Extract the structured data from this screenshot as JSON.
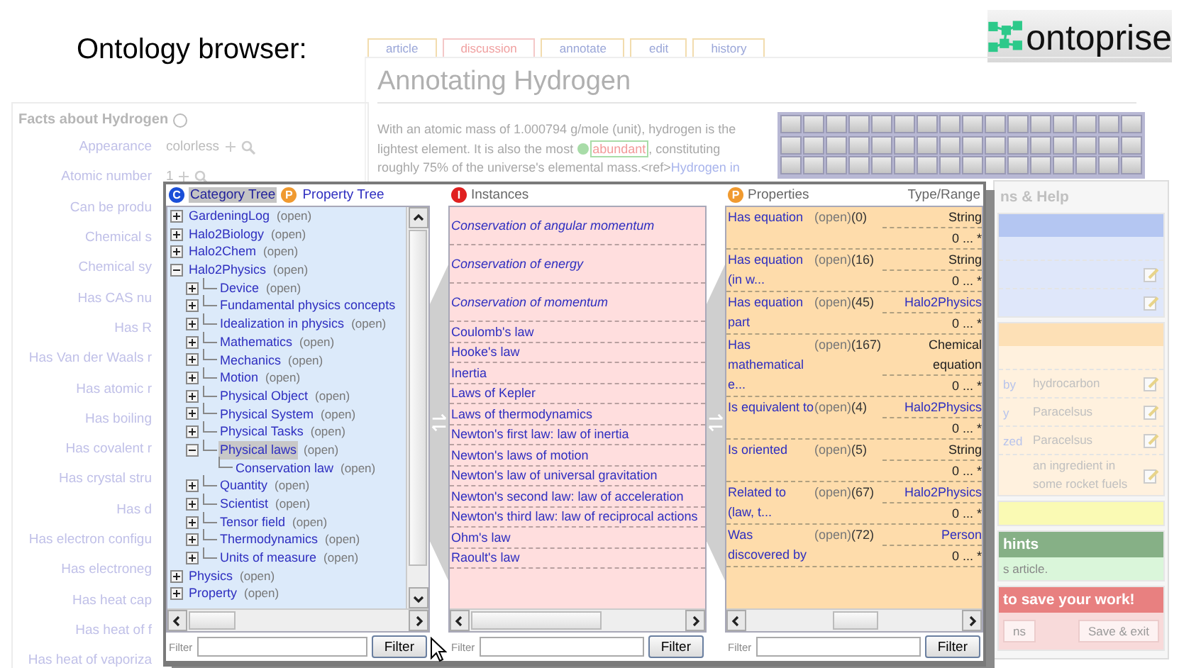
{
  "heading": "Ontology browser:",
  "logo": {
    "text": "ontoprise"
  },
  "wiki": {
    "tabs": [
      {
        "label": "article",
        "kind": "page"
      },
      {
        "label": "discussion",
        "kind": "missing"
      },
      {
        "label": "annotate",
        "kind": "page"
      },
      {
        "label": "edit",
        "kind": "page"
      },
      {
        "label": "history",
        "kind": "page"
      }
    ],
    "title": "Annotating Hydrogen",
    "paragraph": {
      "before": "With an atomic mass of 1.000794 g/mole (unit), hydrogen is the lightest element. It is also the most ",
      "annotated": "abundant",
      "after": ", constituting roughly 75% of the universe's elemental mass.<ref>",
      "link": "Hydrogen in"
    }
  },
  "facts": {
    "title": "Facts about Hydrogen",
    "rows": [
      {
        "label": "Appearance",
        "value": "colorless"
      },
      {
        "label": "Atomic number",
        "value": "1"
      },
      {
        "label": "Can be produ"
      },
      {
        "label": "Chemical s"
      },
      {
        "label": "Chemical sy"
      },
      {
        "label": "Has CAS nu"
      },
      {
        "label": "Has R"
      },
      {
        "label": "Has Van der Waals r"
      },
      {
        "label": "Has atomic r"
      },
      {
        "label": "Has boiling"
      },
      {
        "label": "Has covalent r"
      },
      {
        "label": "Has crystal stru"
      },
      {
        "label": "Has d"
      },
      {
        "label": "Has electron configu"
      },
      {
        "label": "Has electroneg"
      },
      {
        "label": "Has heat cap"
      },
      {
        "label": "Has heat of f"
      },
      {
        "label": "Has heat of vaporiza"
      }
    ]
  },
  "help": {
    "title": "ns & Help",
    "fact_rows": [
      {
        "label": "by",
        "value": "hydrocarbon"
      },
      {
        "label": "y",
        "value": "Paracelsus"
      },
      {
        "label": "zed",
        "value": "Paracelsus"
      },
      {
        "value": "an ingredient in some rocket fuels"
      }
    ],
    "hints_title": "hints",
    "hints_text": "s article.",
    "save_title": "to save your work!",
    "buttons": [
      "ns",
      "Save & exit"
    ]
  },
  "browser": {
    "tree_tabs": [
      {
        "label": "Category Tree",
        "icon": "C",
        "selected": true
      },
      {
        "label": "Property Tree",
        "icon": "P",
        "selected": false
      }
    ],
    "tree": [
      {
        "label": "GardeningLog",
        "note": "(open)",
        "kind": "node",
        "expanded": false,
        "selected": false
      },
      {
        "label": "Halo2Biology",
        "note": "(open)",
        "kind": "node",
        "expanded": false,
        "selected": false
      },
      {
        "label": "Halo2Chem",
        "note": "(open)",
        "kind": "node",
        "expanded": false,
        "selected": false
      },
      {
        "label": "Halo2Physics",
        "note": "(open)",
        "kind": "node",
        "expanded": true,
        "selected": false,
        "children": [
          {
            "label": "Device",
            "note": "(open)",
            "kind": "node",
            "expanded": false,
            "selected": false
          },
          {
            "label": "Fundamental physics concepts",
            "kind": "node",
            "expanded": false,
            "selected": false
          },
          {
            "label": "Idealization in physics",
            "note": "(open)",
            "kind": "node",
            "expanded": false,
            "selected": false
          },
          {
            "label": "Mathematics",
            "note": "(open)",
            "kind": "node",
            "expanded": false,
            "selected": false
          },
          {
            "label": "Mechanics",
            "note": "(open)",
            "kind": "node",
            "expanded": false,
            "selected": false
          },
          {
            "label": "Motion",
            "note": "(open)",
            "kind": "node",
            "expanded": false,
            "selected": false
          },
          {
            "label": "Physical Object",
            "note": "(open)",
            "kind": "node",
            "expanded": false,
            "selected": false
          },
          {
            "label": "Physical System",
            "note": "(open)",
            "kind": "node",
            "expanded": false,
            "selected": false
          },
          {
            "label": "Physical Tasks",
            "note": "(open)",
            "kind": "node",
            "expanded": false,
            "selected": false
          },
          {
            "label": "Physical laws",
            "note": "(open)",
            "kind": "node",
            "expanded": true,
            "selected": true,
            "children": [
              {
                "label": "Conservation law",
                "note": "(open)",
                "kind": "leaf",
                "selected": false
              }
            ]
          },
          {
            "label": "Quantity",
            "note": "(open)",
            "kind": "node",
            "expanded": false,
            "selected": false
          },
          {
            "label": "Scientist",
            "note": "(open)",
            "kind": "node",
            "expanded": false,
            "selected": false
          },
          {
            "label": "Tensor field",
            "note": "(open)",
            "kind": "node",
            "expanded": false,
            "selected": false
          },
          {
            "label": "Thermodynamics",
            "note": "(open)",
            "kind": "node",
            "expanded": false,
            "selected": false
          },
          {
            "label": "Units of measure",
            "note": "(open)",
            "kind": "node",
            "expanded": false,
            "selected": false
          }
        ]
      },
      {
        "label": "Physics",
        "note": "(open)",
        "kind": "node",
        "expanded": false,
        "selected": false
      },
      {
        "label": "Property",
        "note": "(open)",
        "kind": "node",
        "expanded": false,
        "selected": false
      }
    ],
    "tree_filter": {
      "label": "Filter",
      "button": "Filter"
    },
    "instances_header": {
      "icon": "I",
      "label": "Instances"
    },
    "instances": [
      {
        "label": "Conservation of angular momentum",
        "kind": "italic"
      },
      {
        "label": "Conservation of energy",
        "kind": "italic"
      },
      {
        "label": "Conservation of momentum",
        "kind": "italic"
      },
      {
        "label": "Coulomb's law",
        "kind": "plain"
      },
      {
        "label": "Hooke's law",
        "kind": "plain"
      },
      {
        "label": "Inertia",
        "kind": "plain"
      },
      {
        "label": "Laws of Kepler",
        "kind": "plain"
      },
      {
        "label": "Laws of thermodynamics",
        "kind": "plain"
      },
      {
        "label": "Newton's first law: law of inertia",
        "kind": "plain"
      },
      {
        "label": "Newton's laws of motion",
        "kind": "plain"
      },
      {
        "label": "Newton's law of universal gravitation",
        "kind": "plain"
      },
      {
        "label": "Newton's second law: law of acceleration",
        "kind": "plain"
      },
      {
        "label": "Newton's third law: law of reciprocal actions",
        "kind": "plain"
      },
      {
        "label": "Ohm's law",
        "kind": "plain"
      },
      {
        "label": "Raoult's law",
        "kind": "plain"
      }
    ],
    "instances_filter": {
      "label": "Filter",
      "button": "Filter"
    },
    "properties_header": {
      "icon": "P",
      "label": "Properties",
      "range_label": "Type/Range"
    },
    "properties": [
      {
        "name": "Has equation",
        "note": "(open)",
        "count": "(0)",
        "range": "String",
        "kind": "datatype",
        "cardinality": "0 ... *"
      },
      {
        "name": "Has equation (in w...",
        "note": "(open)",
        "count": "(16)",
        "range": "String",
        "kind": "datatype",
        "cardinality": "0 ... *"
      },
      {
        "name": "Has equation part",
        "note": "(open)",
        "count": "(45)",
        "range": "Halo2Physics",
        "kind": "category",
        "cardinality": "0 ... *"
      },
      {
        "name": "Has mathematical e...",
        "note": "(open)",
        "count": "(167)",
        "range": "Chemical equation",
        "kind": "datatype",
        "cardinality": "0 ... *"
      },
      {
        "name": "Is equivalent to",
        "note": "(open)",
        "count": "(4)",
        "range": "Halo2Physics",
        "kind": "category",
        "cardinality": "0 ... *"
      },
      {
        "name": "Is oriented",
        "note": "(open)",
        "count": "(5)",
        "range": "String",
        "kind": "datatype",
        "cardinality": "0 ... *"
      },
      {
        "name": "Related to (law, t...",
        "note": "(open)",
        "count": "(67)",
        "range": "Halo2Physics",
        "kind": "category",
        "cardinality": "0 ... *"
      },
      {
        "name": "Was discovered by",
        "note": "(open)",
        "count": "(72)",
        "range": "Person",
        "kind": "category",
        "cardinality": "0 ... *"
      }
    ],
    "properties_filter": {
      "label": "Filter",
      "button": "Filter"
    }
  }
}
